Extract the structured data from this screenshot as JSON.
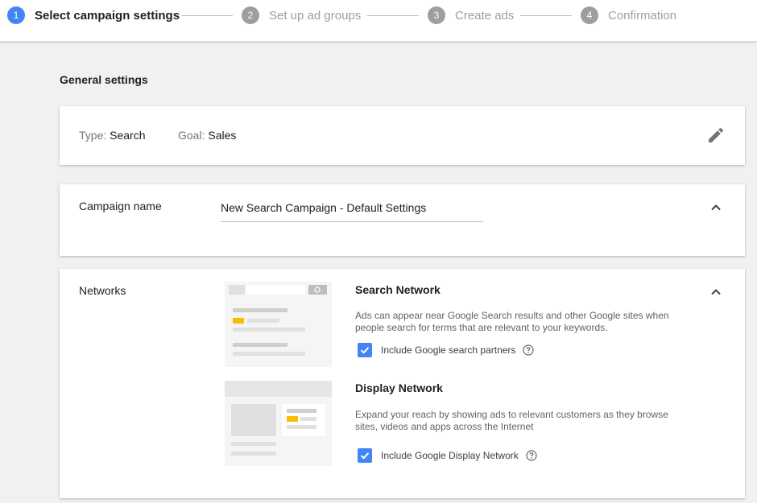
{
  "stepper": {
    "steps": [
      {
        "num": "1",
        "label": "Select campaign settings"
      },
      {
        "num": "2",
        "label": "Set up ad groups"
      },
      {
        "num": "3",
        "label": "Create ads"
      },
      {
        "num": "4",
        "label": "Confirmation"
      }
    ],
    "active_step": 1
  },
  "general": {
    "title": "General settings",
    "type_label": "Type:",
    "type_value": "Search",
    "goal_label": "Goal:",
    "goal_value": "Sales",
    "edit_icon": "pencil-icon"
  },
  "campaign_name": {
    "label": "Campaign name",
    "value": "New Search Campaign - Default Settings",
    "collapse_icon": "chevron-up-icon"
  },
  "networks": {
    "label": "Networks",
    "collapse_icon": "chevron-up-icon",
    "search": {
      "title": "Search Network",
      "description": "Ads can appear near Google Search results and other Google sites when people search for terms that are relevant to your keywords.",
      "checkbox_label": "Include Google search partners",
      "checked": true
    },
    "display": {
      "title": "Display Network",
      "description": "Expand your reach by showing ads to relevant customers as they browse sites, videos and apps across the Internet",
      "checkbox_label": "Include Google Display Network",
      "checked": true
    }
  },
  "colors": {
    "accent": "#4285f4",
    "inactive_step": "#9e9e9e",
    "ad_highlight": "#fbbc05",
    "background": "#f1f1f1"
  }
}
